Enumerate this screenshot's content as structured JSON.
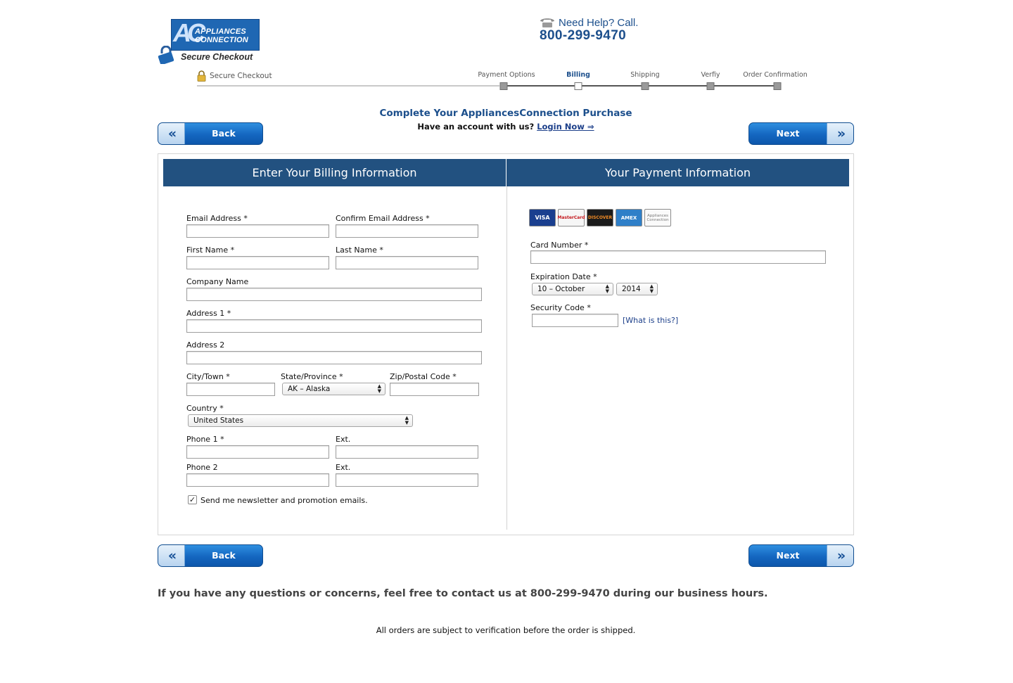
{
  "header": {
    "logo": {
      "mark": "AC",
      "line1": "APPLIANCES",
      "line2": "CONNECTION",
      "secure": "Secure Checkout"
    },
    "help": {
      "text": "Need Help? Call.",
      "phone": "800-299-9470"
    },
    "secure_checkout_label": "Secure Checkout"
  },
  "steps": [
    {
      "label": "Payment Options",
      "active": false
    },
    {
      "label": "Billing",
      "active": true
    },
    {
      "label": "Shipping",
      "active": false
    },
    {
      "label": "Verfiy",
      "active": false
    },
    {
      "label": "Order Confirmation",
      "active": false
    }
  ],
  "title": "Complete Your AppliancesConnection Purchase",
  "account": {
    "prompt": "Have an account with us?",
    "link": "Login Now ⇒"
  },
  "buttons": {
    "back": "Back",
    "next": "Next",
    "back_icon": "«",
    "next_icon": "»"
  },
  "billing": {
    "header": "Enter Your Billing Information",
    "email_label": "Email Address *",
    "confirm_email_label": "Confirm Email Address *",
    "first_name_label": "First Name *",
    "last_name_label": "Last Name *",
    "company_label": "Company Name",
    "address1_label": "Address 1 *",
    "address2_label": "Address 2",
    "city_label": "City/Town *",
    "state_label": "State/Province *",
    "state_value": "AK – Alaska",
    "zip_label": "Zip/Postal Code *",
    "country_label": "Country *",
    "country_value": "United States",
    "phone1_label": "Phone 1 *",
    "ext1_label": "Ext.",
    "phone2_label": "Phone 2",
    "ext2_label": "Ext.",
    "newsletter_label": "Send me newsletter and promotion emails.",
    "newsletter_checked": "✓"
  },
  "payment": {
    "header": "Your Payment Information",
    "cards": [
      {
        "name": "VISA",
        "bg": "#1a3f8f",
        "fg": "#ffffff"
      },
      {
        "name": "MasterCard",
        "bg": "#f6f6f6",
        "fg": "#c3161c"
      },
      {
        "name": "DISCOVER",
        "bg": "#1b1b1b",
        "fg": "#f08a24"
      },
      {
        "name": "AMEX",
        "bg": "#2f7fc8",
        "fg": "#ffffff"
      },
      {
        "name": "Appliances Connection",
        "bg": "#fafafa",
        "fg": "#777777"
      }
    ],
    "card_number_label": "Card Number *",
    "expiration_label": "Expiration Date *",
    "exp_month": "10 – October",
    "exp_year": "2014",
    "security_label": "Security Code *",
    "what_is_this": "[What is this?]"
  },
  "footer": {
    "questions": "If you have any questions or concerns, feel free to contact us at 800-299-9470 during our business hours.",
    "note": "All orders are subject to verification before the order is shipped."
  },
  "colors": {
    "panel_header": "#225180",
    "brand_blue": "#1c4f8c",
    "button_blue": "#1466c0"
  }
}
